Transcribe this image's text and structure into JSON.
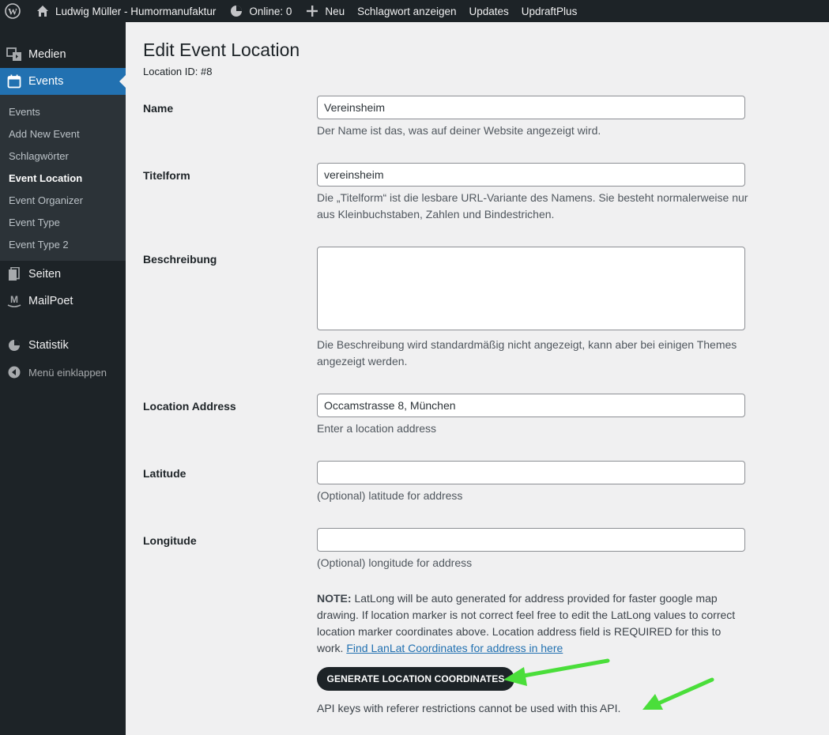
{
  "adminbar": {
    "site_name": "Ludwig Müller - Humormanufaktur",
    "online": "Online: 0",
    "new": "Neu",
    "view_tag": "Schlagwort anzeigen",
    "updates": "Updates",
    "updraft": "UpdraftPlus"
  },
  "sidebar": {
    "media": "Medien",
    "events": "Events",
    "submenu": [
      "Events",
      "Add New Event",
      "Schlagwörter",
      "Event Location",
      "Event Organizer",
      "Event Type",
      "Event Type 2"
    ],
    "pages": "Seiten",
    "mailpoet": "MailPoet",
    "stats": "Statistik",
    "collapse": "Menü einklappen"
  },
  "page": {
    "title": "Edit Event Location",
    "location_id": "Location ID: #8"
  },
  "form": {
    "name": {
      "label": "Name",
      "value": "Vereinsheim",
      "desc": "Der Name ist das, was auf deiner Website angezeigt wird."
    },
    "slug": {
      "label": "Titelform",
      "value": "vereinsheim",
      "desc": "Die „Titelform“ ist die lesbare URL-Variante des Namens. Sie besteht normalerweise nur aus Kleinbuchstaben, Zahlen und Bindestrichen."
    },
    "description": {
      "label": "Beschreibung",
      "value": "",
      "desc": "Die Beschreibung wird standardmäßig nicht angezeigt, kann aber bei einigen Themes angezeigt werden."
    },
    "address": {
      "label": "Location Address",
      "value": "Occamstrasse 8, München",
      "desc": "Enter a location address"
    },
    "latitude": {
      "label": "Latitude",
      "value": "",
      "desc": "(Optional) latitude for address"
    },
    "longitude": {
      "label": "Longitude",
      "value": "",
      "desc": "(Optional) longitude for address"
    }
  },
  "note": {
    "strong": "NOTE:",
    "text": " LatLong will be auto generated for address provided for faster google map drawing. If location marker is not correct feel free to edit the LatLong values to correct location marker coordinates above. Location address field is REQUIRED for this to work. ",
    "link": "Find LanLat Coordinates for address in here"
  },
  "generate_button": "GENERATE LOCATION COORDINATES",
  "api_note": "API keys with referer restrictions cannot be used with this API.",
  "colors": {
    "accent": "#2271b1",
    "admin_bg": "#1d2327",
    "arrow": "#4ade3a"
  }
}
